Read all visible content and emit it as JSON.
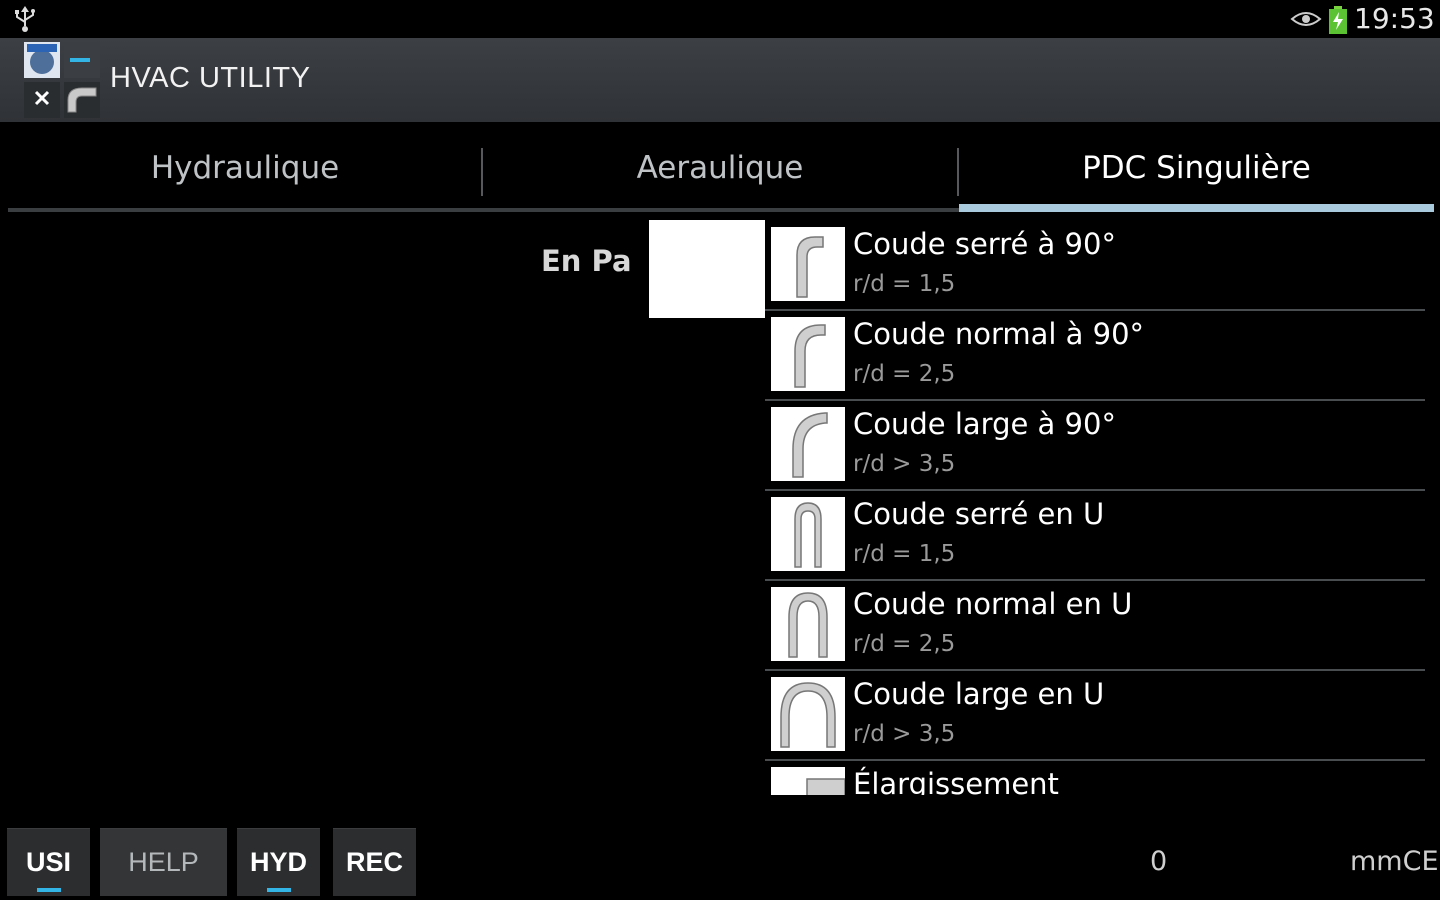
{
  "status_bar": {
    "time": "19:53",
    "icons": [
      "usb-icon",
      "eye-icon",
      "battery-charging-icon"
    ]
  },
  "action_bar": {
    "title": "HVAC UTILITY",
    "icon": "app-icon"
  },
  "tabs": [
    {
      "label": "Hydraulique",
      "active": false
    },
    {
      "label": "Aeraulique",
      "active": false
    },
    {
      "label": "PDC Singulière",
      "active": true
    }
  ],
  "main": {
    "unit_label": "En Pa",
    "value_input": ""
  },
  "fittings": [
    {
      "title": "Coude serré à 90°",
      "subtitle": "r/d = 1,5",
      "icon": "tight-elbow-90-icon"
    },
    {
      "title": "Coude normal à 90°",
      "subtitle": "r/d = 2,5",
      "icon": "normal-elbow-90-icon"
    },
    {
      "title": "Coude large à 90°",
      "subtitle": "r/d > 3,5",
      "icon": "wide-elbow-90-icon"
    },
    {
      "title": "Coude serré en U",
      "subtitle": "r/d = 1,5",
      "icon": "tight-u-bend-icon"
    },
    {
      "title": "Coude normal en U",
      "subtitle": "r/d = 2,5",
      "icon": "normal-u-bend-icon"
    },
    {
      "title": "Coude large en U",
      "subtitle": "r/d > 3,5",
      "icon": "wide-u-bend-icon"
    },
    {
      "title": "Élargissement",
      "subtitle": "",
      "icon": "enlargement-icon"
    }
  ],
  "bottom_bar": {
    "buttons": [
      {
        "label": "USI",
        "selected": true
      },
      {
        "label": "HELP",
        "selected": false
      },
      {
        "label": "HYD",
        "selected": true
      },
      {
        "label": "REC",
        "selected": false
      }
    ],
    "result_value": "0",
    "result_unit": "mmCE"
  },
  "colors": {
    "action_bar": "#3c4044",
    "tab_indicator": "#a9c9dd",
    "button_underline": "#33b5e5"
  }
}
